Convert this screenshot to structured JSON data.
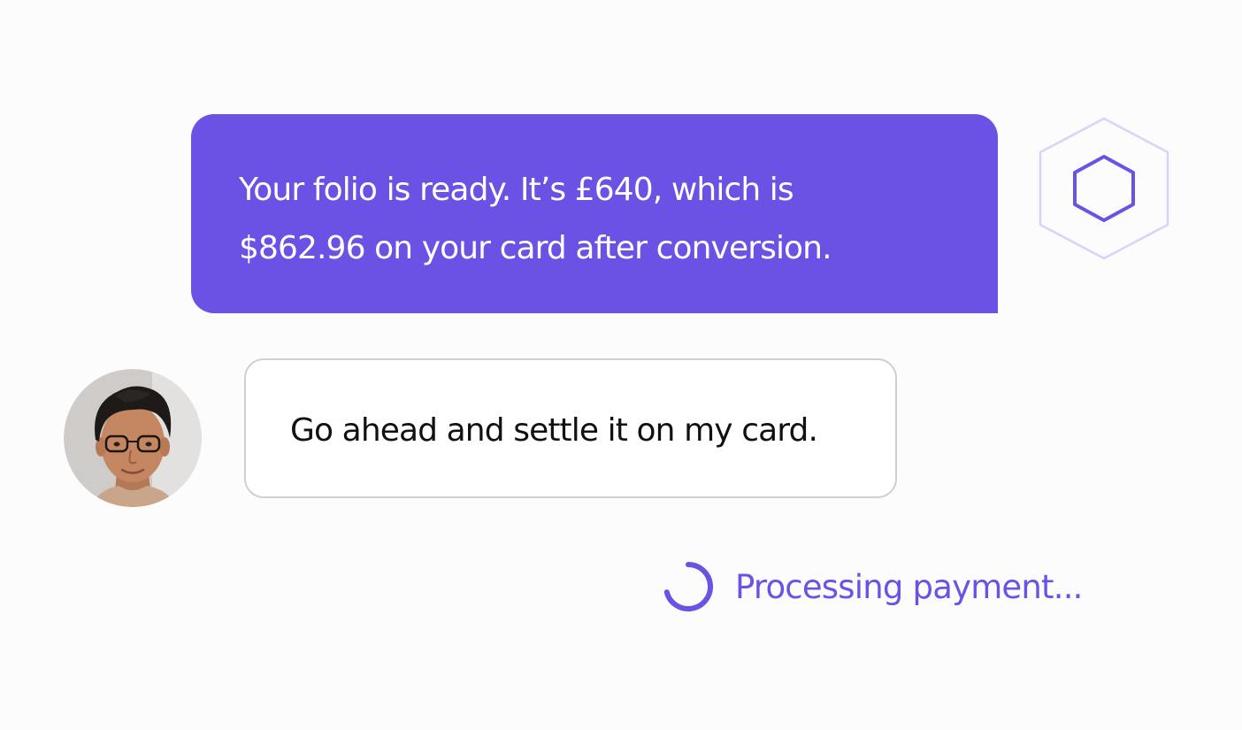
{
  "conversation": {
    "agent_message": {
      "lines": [
        "Your folio is ready. It’s £640, which is",
        "$862.96 on your card after conversion."
      ]
    },
    "agent_avatar": {
      "icon": "hexagon-icon"
    },
    "user_message": {
      "text": "Go ahead and settle it on my card."
    },
    "user_avatar": {
      "icon": "user-photo"
    }
  },
  "status": {
    "icon": "spinner-icon",
    "text": "Processing payment..."
  },
  "colors": {
    "accent": "#6b52e5",
    "accent_light": "#d9d2fa",
    "background": "#fcfcfd",
    "user_bubble_border": "#cfcfcf"
  }
}
